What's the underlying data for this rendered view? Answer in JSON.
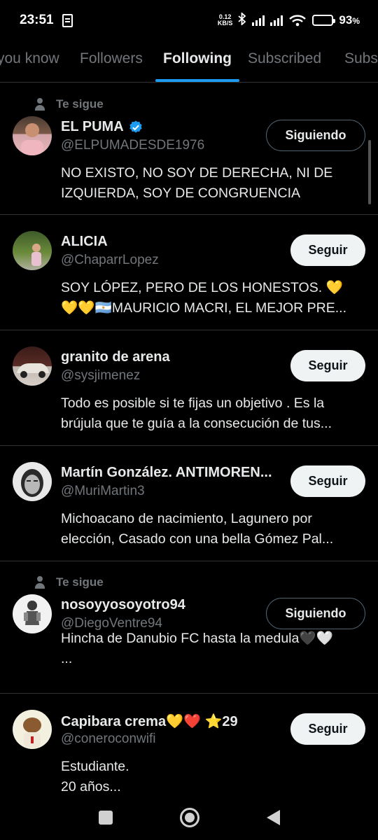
{
  "status_bar": {
    "time": "23:51",
    "net_speed_value": "0.12",
    "net_speed_unit": "KB/S",
    "battery_pct": "93",
    "battery_percent_sign": "%",
    "battery_level": 0.93,
    "icons": [
      "notes-icon",
      "bluetooth-icon",
      "signal-icon",
      "signal-icon",
      "wifi-icon",
      "battery-icon"
    ]
  },
  "tabs": [
    {
      "label": "you know",
      "active": false
    },
    {
      "label": "Followers",
      "active": false
    },
    {
      "label": "Following",
      "active": true
    },
    {
      "label": "Subscribed",
      "active": false
    },
    {
      "label": "Subs",
      "active": false
    }
  ],
  "accent_color": "#1d9bf0",
  "users": [
    {
      "follows_you": "Te sigue",
      "name": "EL PUMA",
      "verified": true,
      "handle": "@ELPUMADESDE1976",
      "button": "Siguiendo",
      "bio": "NO EXISTO, NO SOY DE DERECHA, NI DE IZQUIERDA, SOY DE CONGRUENCIA"
    },
    {
      "name": "ALICIA",
      "handle": "@ChaparrLopez",
      "button": "Seguir",
      "bio_line1": "SOY LÓPEZ, PERO DE LOS HONESTOS. 💛",
      "bio_line2": "💛💛🇦🇷MAURICIO MACRI, EL MEJOR PRE..."
    },
    {
      "name": "granito de arena",
      "handle": "@sysjimenez",
      "button": "Seguir",
      "bio_line1": "Todo es posible si te fijas un objetivo . Es la",
      "bio_line2": "brújula que te guía  a la consecución de tus..."
    },
    {
      "name": "Martín González. ANTIMOREN...",
      "handle": "@MuriMartin3",
      "button": "Seguir",
      "bio_line1": "Michoacano de nacimiento, Lagunero por",
      "bio_line2": "elección, Casado con una bella Gómez Pal..."
    },
    {
      "follows_you": "Te sigue",
      "name": "nosoyyosoyotro94",
      "handle": "@DiegoVentre94",
      "button": "Siguiendo",
      "bio_line1": "Hincha de Danubio FC hasta la medula🖤🤍",
      "bio_line2": "..."
    },
    {
      "name": "Capibara crema💛❤️ ⭐29",
      "handle": "@coneroconwifi",
      "button": "Seguir",
      "bio_line1": "Estudiante.",
      "bio_line2": "20 años..."
    }
  ],
  "nav": {
    "icons": [
      "recents-square-icon",
      "home-circle-icon",
      "back-triangle-icon"
    ]
  }
}
